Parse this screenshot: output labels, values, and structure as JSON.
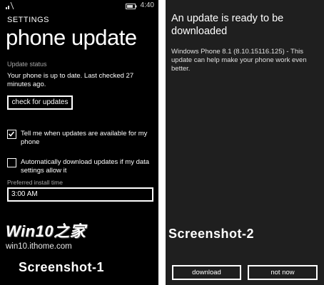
{
  "screenshot1": {
    "status_bar": {
      "clock": "4:40",
      "signal_icon": "signal-bars-icon",
      "battery_icon": "battery-icon"
    },
    "header": {
      "app_label": "SETTINGS",
      "title": "phone update"
    },
    "update_status": {
      "label": "Update status",
      "text": "Your phone is up to date. Last checked 27 minutes ago."
    },
    "check_button_label": "check for updates",
    "options": [
      {
        "label": "Tell me when updates are available for my phone",
        "checked": true
      },
      {
        "label": "Automatically download updates if my data settings allow it",
        "checked": false
      }
    ],
    "install_time": {
      "label": "Preferred install time",
      "value": "3:00 AM"
    },
    "watermark": {
      "logo": "Win10之家",
      "url": "win10.ithome.com"
    },
    "caption": "Screenshot-1"
  },
  "screenshot2": {
    "title": "An update is ready to be downloaded",
    "description": "Windows Phone 8.1 (8.10.15116.125) - This update can help make your phone work even better.",
    "caption": "Screenshot-2",
    "buttons": {
      "download": "download",
      "not_now": "not now"
    }
  },
  "colors": {
    "screen1_bg": "#000000",
    "screen2_bg": "#1f1f1f",
    "foreground": "#ffffff",
    "subtle_text": "#a6a6a6"
  }
}
